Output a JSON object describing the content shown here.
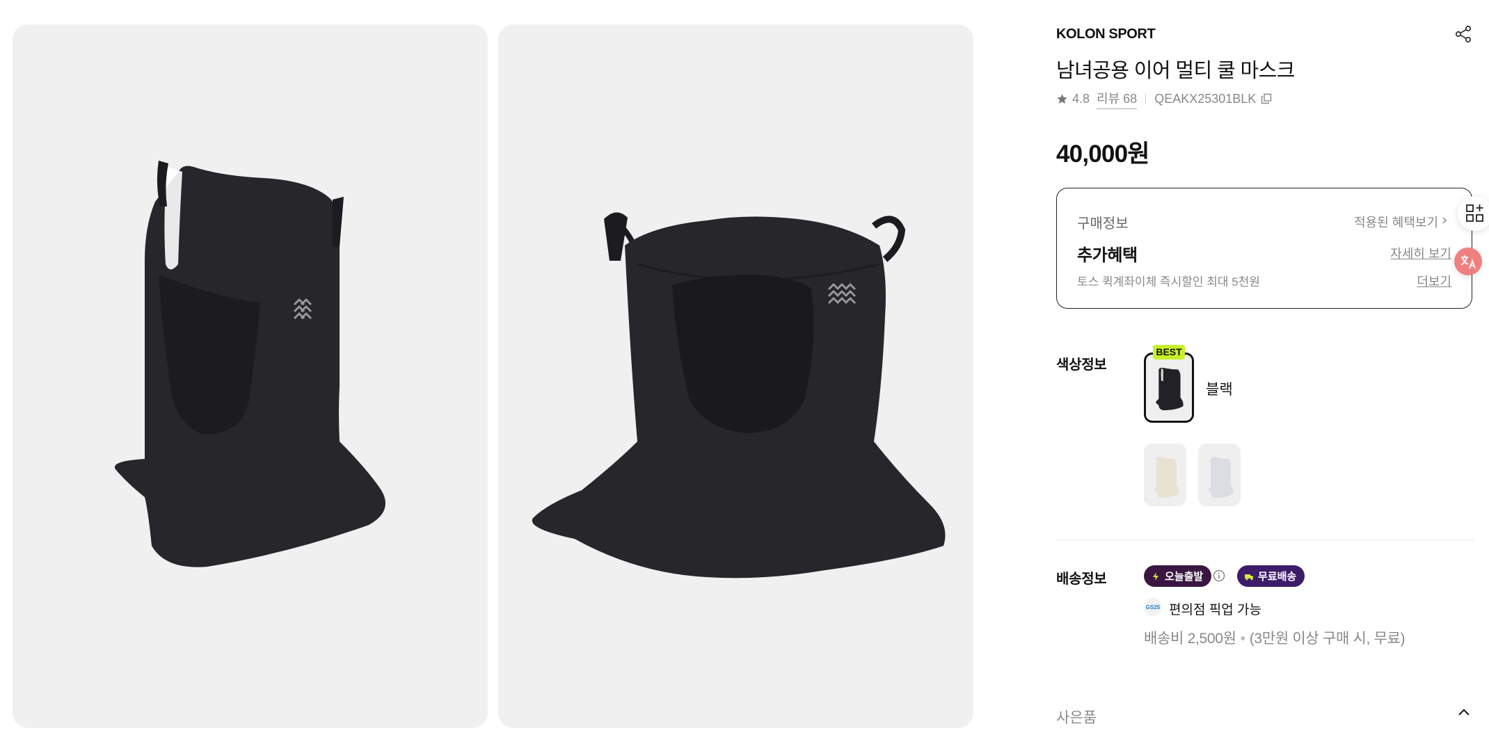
{
  "gallery": {
    "images": [
      {
        "alt": "product-image-side-view"
      },
      {
        "alt": "product-image-front-view"
      }
    ]
  },
  "product": {
    "brand": "KOLON SPORT",
    "name": "남녀공용 이어 멀티 쿨 마스크",
    "rating": "4.8",
    "review_label": "리뷰 68",
    "sku": "QEAKX25301BLK",
    "price": "40,000원"
  },
  "benefit": {
    "label": "구매정보",
    "applied_link": "적용된 혜택보기",
    "heading": "추가혜택",
    "detail_link": "자세히 보기",
    "description": "토스 퀵계좌이체 즉시할인 최대 5천원",
    "more_link": "더보기"
  },
  "color": {
    "label": "색상정보",
    "best_badge": "BEST",
    "selected_name": "블랙",
    "options": [
      {
        "name": "블랙",
        "color": "#1e1e22"
      },
      {
        "name": "beige",
        "color": "#e8e2d2"
      },
      {
        "name": "light-gray",
        "color": "#dcdde2"
      }
    ]
  },
  "shipping": {
    "label": "배송정보",
    "badges": {
      "today": "오늘출발",
      "free": "무료배송"
    },
    "pickup_logo": "GS25",
    "pickup": "편의점 픽업 가능",
    "fee": "배송비 2,500원",
    "fee_note": "(3만원 이상 구매 시, 무료)"
  },
  "gift": {
    "label": "사은품"
  },
  "icons": {
    "share": "share-icon",
    "star": "star-icon",
    "copy": "copy-icon",
    "info": "info-icon",
    "chevron_up": "chevron-up-icon",
    "apps": "apps-grid-icon",
    "translate": "translate-icon"
  },
  "colors": {
    "accent_best": "#c8f02a",
    "badge_today": "#3a1740",
    "badge_free": "#3d1c6a",
    "translate_float": "#f08080"
  }
}
